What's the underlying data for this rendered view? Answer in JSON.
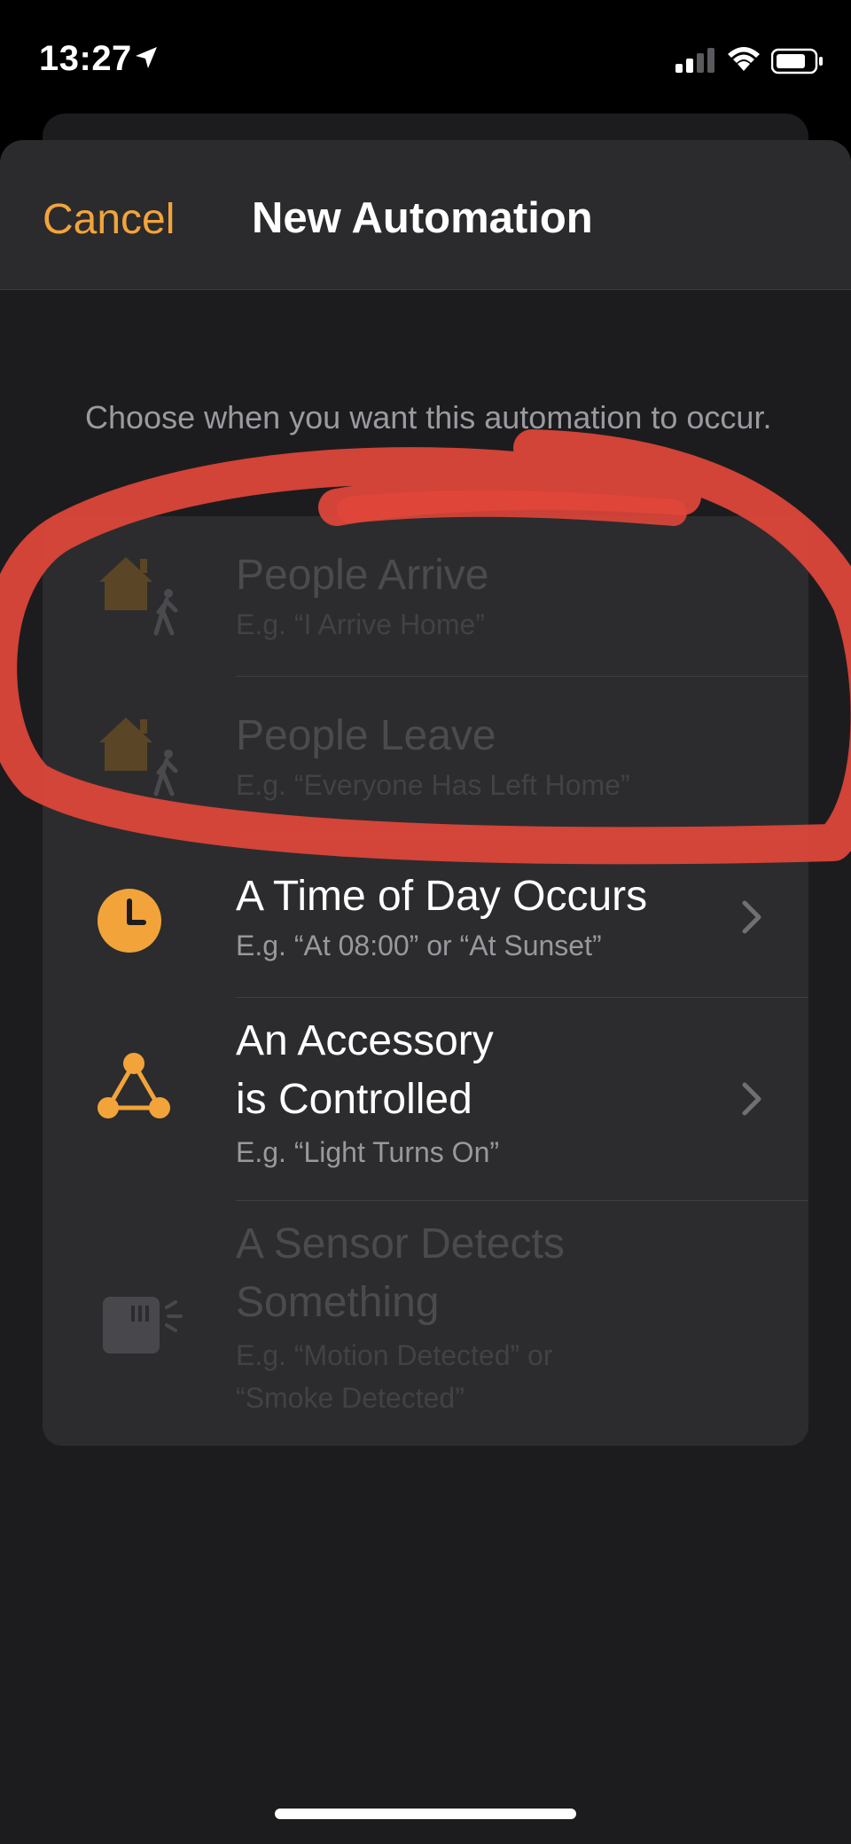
{
  "status_bar": {
    "time": "13:27",
    "icons": [
      "location-arrow-icon",
      "cellular-signal-icon",
      "wifi-icon",
      "battery-icon"
    ]
  },
  "nav": {
    "cancel_label": "Cancel",
    "title": "New Automation"
  },
  "intro_text": "Choose when you want this automation to occur.",
  "triggers": [
    {
      "title": "People Arrive",
      "subtitle": "E.g. “I Arrive Home”",
      "enabled": false,
      "icon": "person-arriving-home-icon"
    },
    {
      "title": "People Leave",
      "subtitle": "E.g. “Everyone Has Left Home”",
      "enabled": false,
      "icon": "person-leaving-home-icon"
    },
    {
      "title": "A Time of Day Occurs",
      "subtitle": "E.g. “At 08:00” or “At Sunset”",
      "enabled": true,
      "icon": "clock-icon"
    },
    {
      "title_line1": "An Accessory",
      "title_line2": "is Controlled",
      "subtitle": "E.g. “Light Turns On”",
      "enabled": true,
      "icon": "accessory-network-icon"
    },
    {
      "title_line1": "A Sensor Detects",
      "title_line2": "Something",
      "subtitle_line1": "E.g. “Motion Detected” or",
      "subtitle_line2": "“Smoke Detected”",
      "enabled": false,
      "icon": "sensor-icon"
    }
  ],
  "colors": {
    "accent": "#f2a43a",
    "annotation": "#e0463a",
    "sheet_background": "#1c1c1e",
    "card_background": "#2c2c2e"
  }
}
